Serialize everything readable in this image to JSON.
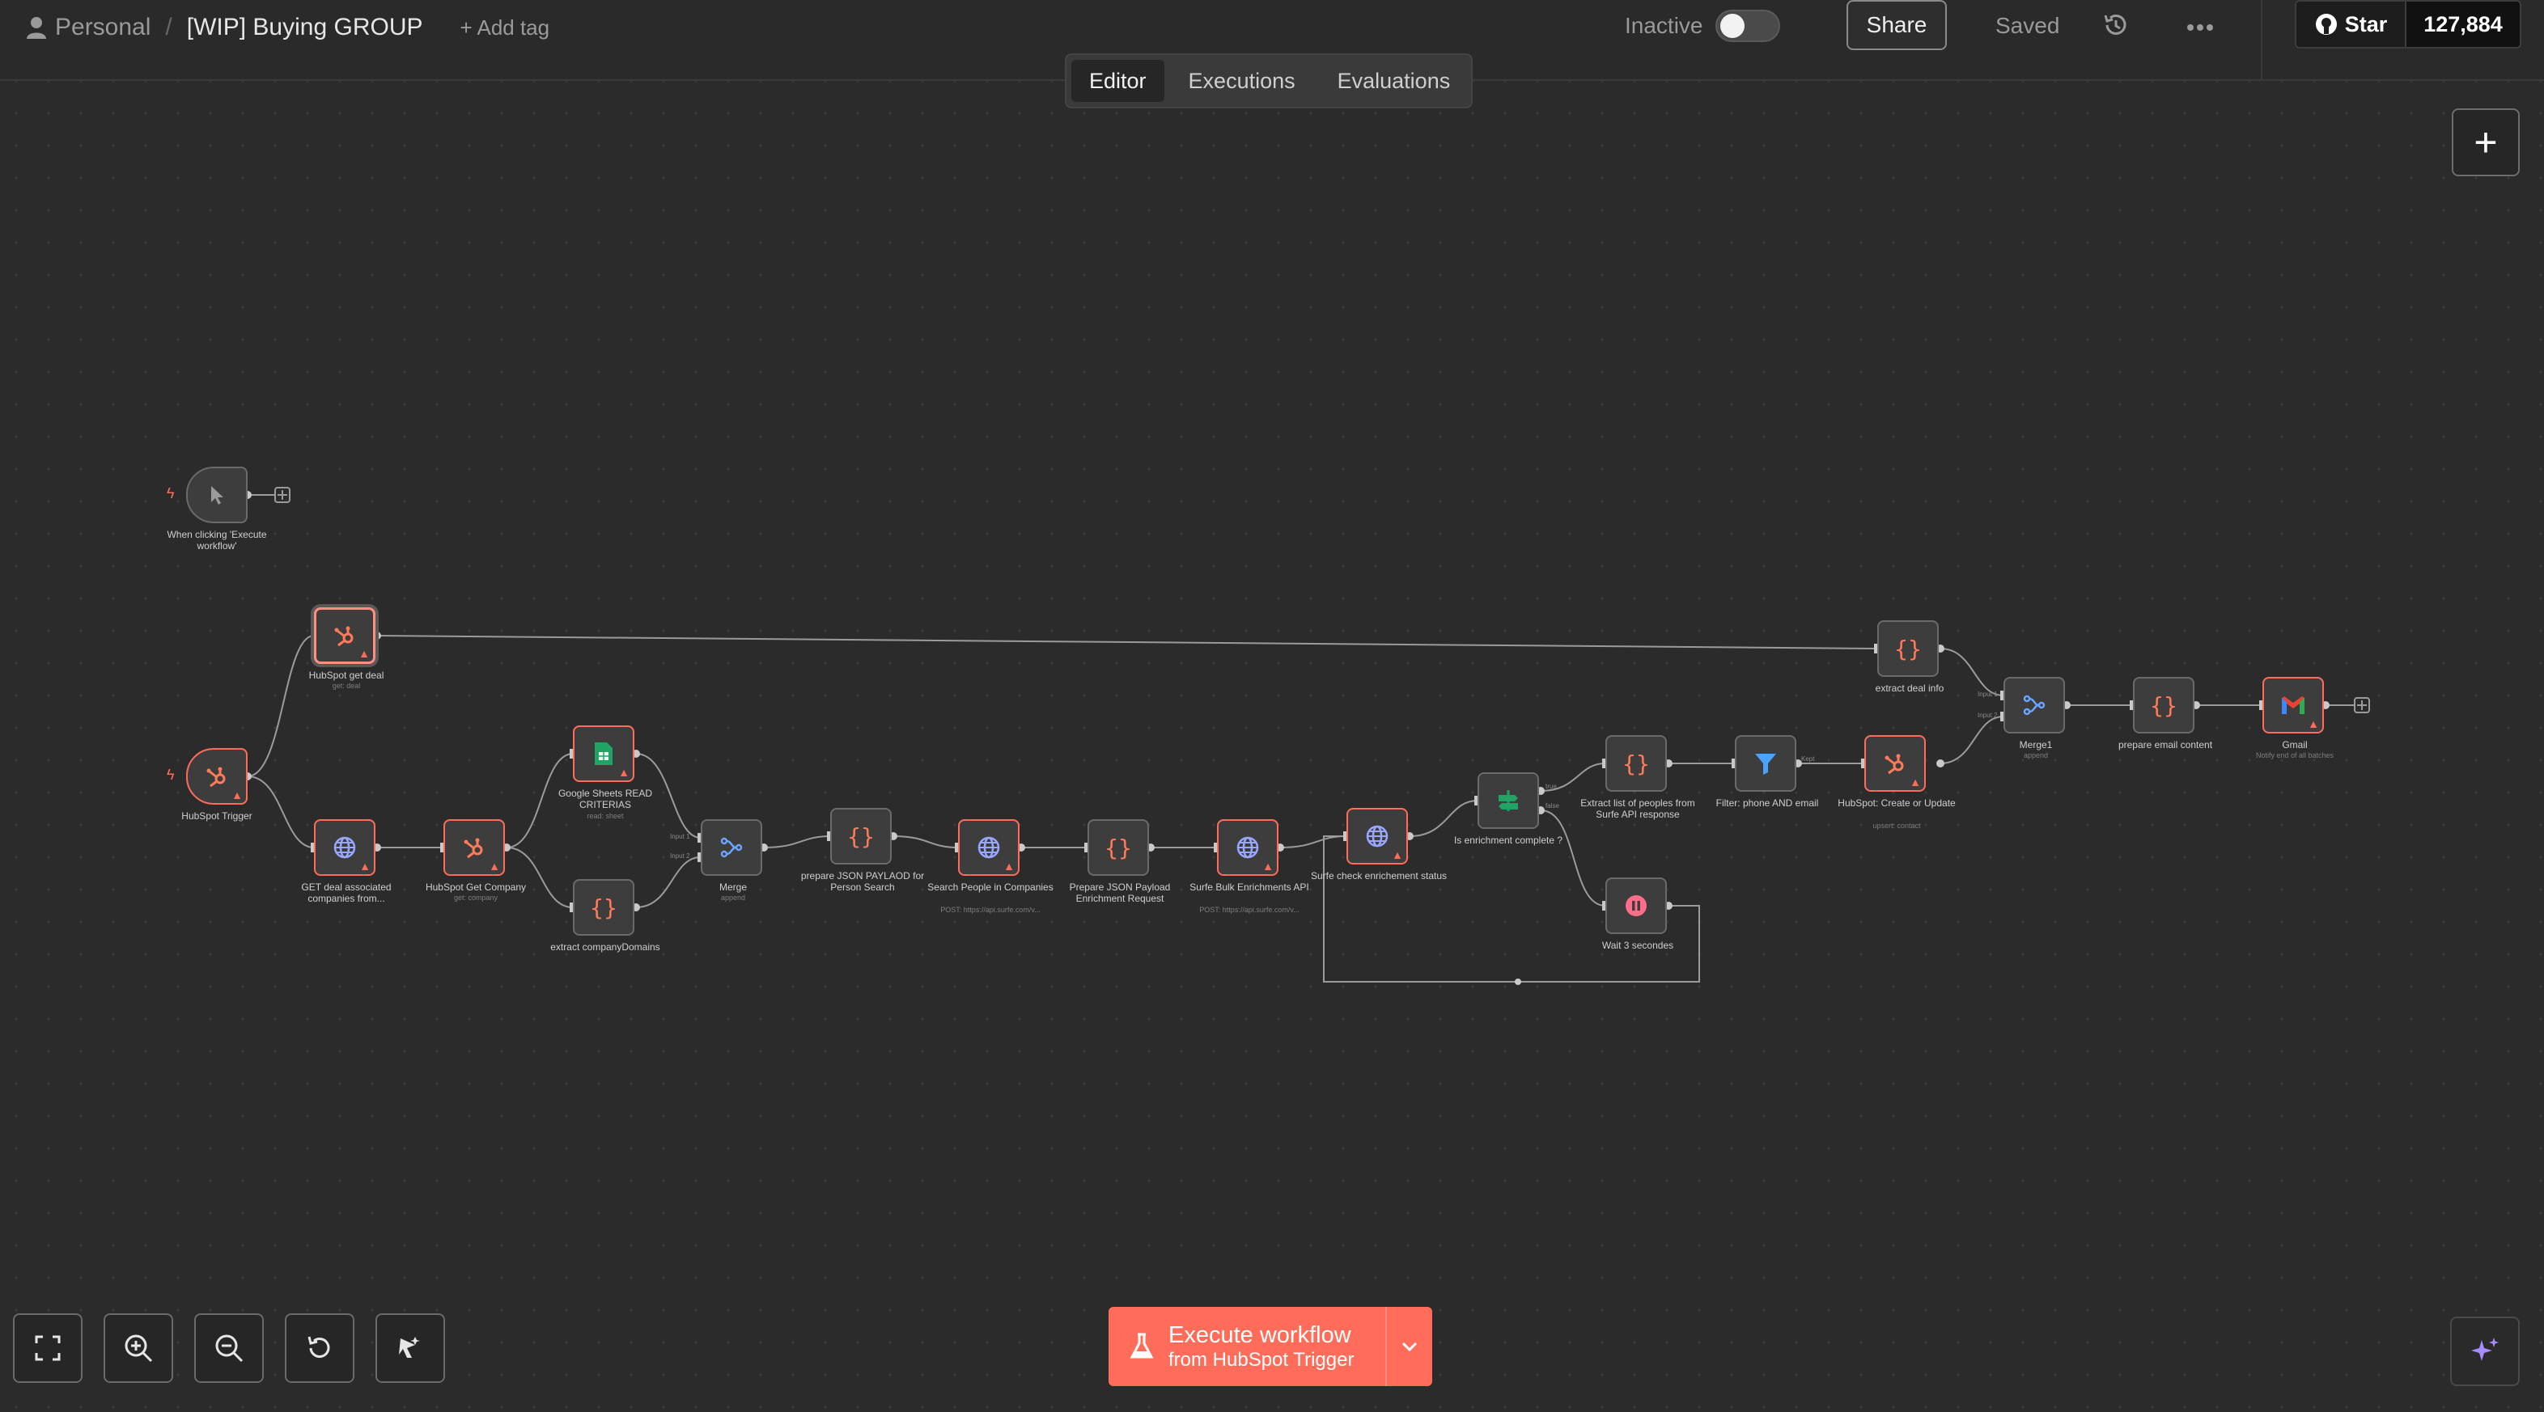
{
  "header": {
    "project": "Personal",
    "separator": "/",
    "workflow_name": "[WIP] Buying GROUP",
    "add_tag": "+ Add tag",
    "status": "Inactive",
    "share": "Share",
    "saved": "Saved",
    "github_star": "Star",
    "github_count": "127,884"
  },
  "tabs": [
    "Editor",
    "Executions",
    "Evaluations"
  ],
  "nodes": {
    "manual": {
      "label": "When clicking 'Execute workflow'",
      "sub": ""
    },
    "hs_get_deal": {
      "label": "HubSpot get deal",
      "sub": "get: deal"
    },
    "hs_trigger": {
      "label": "HubSpot Trigger",
      "sub": ""
    },
    "get_assoc": {
      "label": "GET deal associated companies from...",
      "sub": ""
    },
    "hs_get_company": {
      "label": "HubSpot Get Company",
      "sub": "get: company"
    },
    "gsheets": {
      "label": "Google Sheets READ CRITERIAS",
      "sub": "read: sheet"
    },
    "extract_domains": {
      "label": "extract companyDomains",
      "sub": ""
    },
    "merge": {
      "label": "Merge",
      "sub": "append"
    },
    "prep_person": {
      "label": "prepare JSON PAYLAOD for Person Search",
      "sub": ""
    },
    "search_people": {
      "label": "Search People in Companies",
      "sub": "POST: https://api.surfe.com/v..."
    },
    "prep_enrich": {
      "label": "Prepare JSON Payload Enrichment Request",
      "sub": ""
    },
    "surfe_bulk": {
      "label": "Surfe Bulk Enrichments API",
      "sub": "POST: https://api.surfe.com/v..."
    },
    "surfe_check": {
      "label": "Surfe check enrichement status",
      "sub": ""
    },
    "is_complete": {
      "label": "Is enrichment complete ?",
      "sub": ""
    },
    "wait": {
      "label": "Wait 3 secondes",
      "sub": ""
    },
    "extract_list": {
      "label": "Extract list of peoples from Surfe API response",
      "sub": ""
    },
    "filter": {
      "label": "Filter: phone AND email",
      "sub": ""
    },
    "hs_create": {
      "label": "HubSpot: Create or Update",
      "sub": "upsert: contact"
    },
    "extract_deal": {
      "label": "extract deal info",
      "sub": ""
    },
    "merge1": {
      "label": "Merge1",
      "sub": "append"
    },
    "prep_email": {
      "label": "prepare email content",
      "sub": ""
    },
    "gmail": {
      "label": "Gmail",
      "sub": "Notify end of all batches"
    }
  },
  "port_labels": {
    "input1": "Input 1",
    "input2": "Input 2",
    "true": "true",
    "false": "false",
    "kept": "Kept"
  },
  "execute": {
    "line1": "Execute workflow",
    "line2": "from HubSpot Trigger"
  },
  "colors": {
    "accent": "#ff6d5a",
    "hubspot": "#ff7a59",
    "sheets": "#21a366",
    "merge": "#6ba4ff",
    "filter": "#4aa3ff",
    "http": "#9aa7ff"
  },
  "icons": {
    "toolbar": [
      "fit-view-icon",
      "zoom-in-icon",
      "zoom-out-icon",
      "reset-zoom-icon",
      "tidy-up-icon"
    ]
  }
}
